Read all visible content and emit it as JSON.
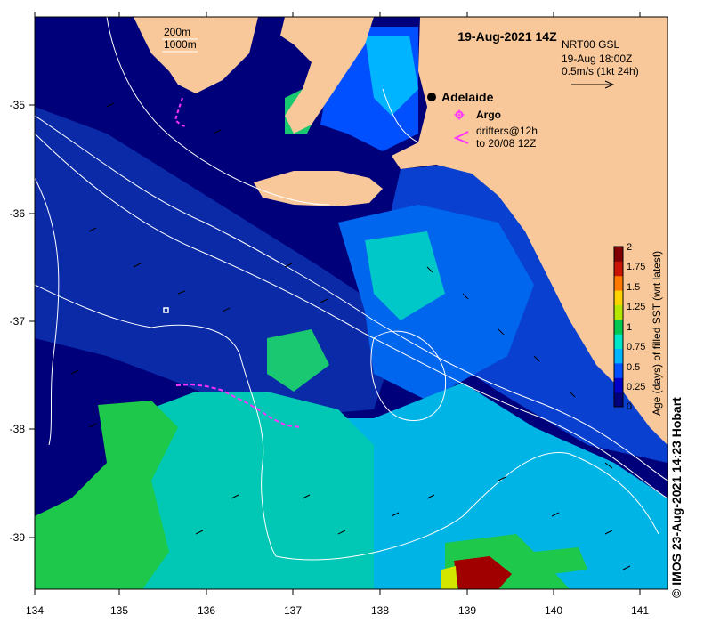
{
  "title": "19-Aug-2021 14Z",
  "scale_key": {
    "line1": "200m",
    "line2": "1000m"
  },
  "product": {
    "name": "NRT00 GSL",
    "time": "19-Aug 18:00Z",
    "vector_scale": "0.5m/s (1kt 24h)"
  },
  "places": [
    {
      "name": "Adelaide"
    }
  ],
  "legend": {
    "argo": "Argo",
    "drifters_line1": "drifters@12h",
    "drifters_line2": "to 20/08 12Z",
    "argo_color": "#ff33ff",
    "drifter_color": "#ff33ff"
  },
  "axes": {
    "x_ticks": [
      "134",
      "135",
      "136",
      "137",
      "138",
      "139",
      "140",
      "141"
    ],
    "y_ticks": [
      "-35",
      "-36",
      "-37",
      "-38",
      "-39"
    ]
  },
  "colorbar": {
    "label": "Age (days) of filled SST (wrt latest)",
    "ticks": [
      "2",
      "1.75",
      "1.5",
      "1.25",
      "1",
      "0.75",
      "0.5",
      "0.25",
      "0"
    ],
    "colors": [
      "#00007a",
      "#0000c8",
      "#0050ff",
      "#00b4ff",
      "#00e6c8",
      "#00c850",
      "#b4e600",
      "#ffd200",
      "#ff7800",
      "#c81400",
      "#800000"
    ]
  },
  "colors": {
    "land": "#f8c89a",
    "ocean_deep": "#00007a",
    "ocean_mid": "#0a1a9a"
  },
  "credit": "© IMOS 23-Aug-2021 14:23 Hobart"
}
